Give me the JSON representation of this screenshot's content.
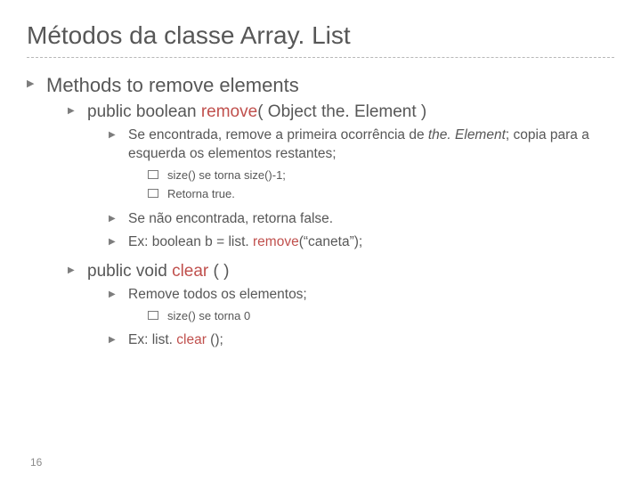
{
  "title": "Métodos da classe Array. List",
  "page_number": "16",
  "colors": {
    "accent": "#c0504d"
  },
  "l1": {
    "text": "Methods to remove elements"
  },
  "m_remove": {
    "sig_pre": "public boolean ",
    "sig_name": "remove",
    "sig_post": "( Object the. Element )",
    "found_pre": "Se encontrada, remove a primeira ocorrência de ",
    "found_it": "the. Element",
    "found_post": "; copia para a esquerda os elementos restantes;",
    "sub1": "size() se torna size()-1;",
    "sub2": "Retorna true.",
    "notfound": "Se não encontrada, retorna false.",
    "ex_pre": "Ex:  boolean b = list. ",
    "ex_name": "remove",
    "ex_post": "(“caneta”);"
  },
  "m_clear": {
    "sig_pre": "public void ",
    "sig_name": "clear",
    "sig_post": " ( )",
    "desc": "Remove todos os elementos;",
    "sub1": "size() se torna 0",
    "ex_pre": "Ex:  list. ",
    "ex_name": "clear",
    "ex_post": " ();"
  }
}
